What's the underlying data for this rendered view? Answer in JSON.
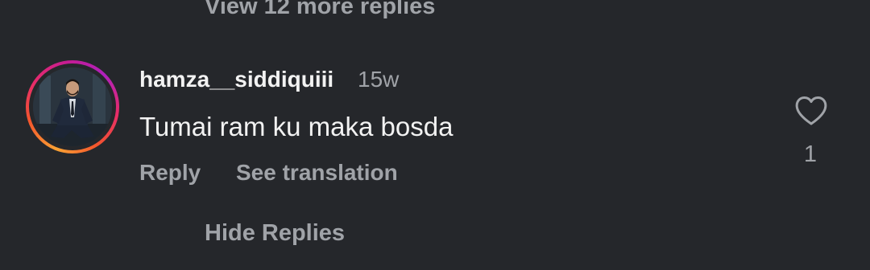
{
  "thread": {
    "view_more_label": "View 12 more replies",
    "hide_replies_label": "Hide Replies"
  },
  "comment": {
    "username": "hamza__siddiquiii",
    "timestamp": "15w",
    "text": "Tumai ram ku maka bosda",
    "reply_label": "Reply",
    "see_translation_label": "See translation",
    "like_icon": "heart-outline-icon",
    "like_count": "1"
  },
  "colors": {
    "background": "#25272b",
    "primary_text": "#f2f2f2",
    "secondary_text": "#a0a3a8",
    "story_ring": [
      "#f9a234",
      "#e62b6b",
      "#b021bc"
    ]
  }
}
